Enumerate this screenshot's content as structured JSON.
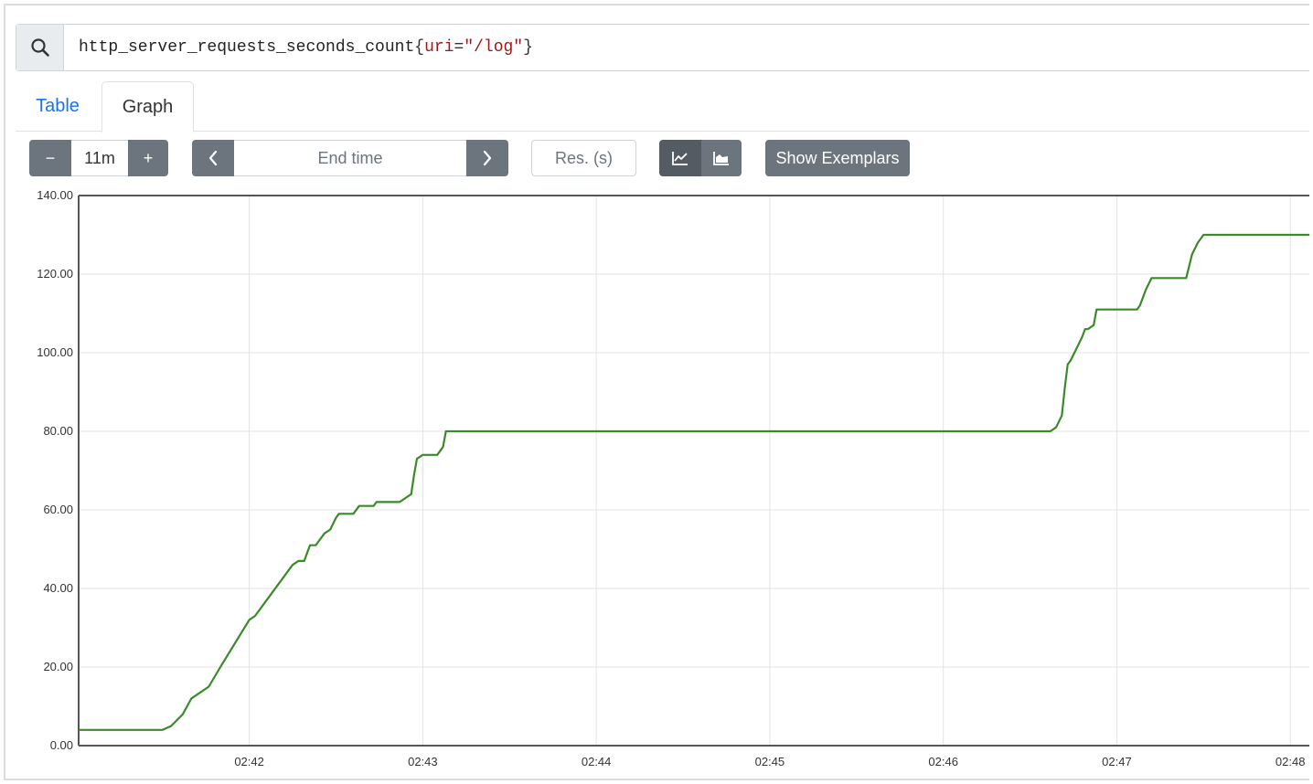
{
  "query": {
    "metric": "http_server_requests_seconds_count",
    "open_brace": "{",
    "label_name": "uri",
    "operator": "=",
    "label_value": "\"/log\"",
    "close_brace": "}",
    "search_icon": "search-icon"
  },
  "tabs": {
    "table_label": "Table",
    "graph_label": "Graph",
    "active": "Graph"
  },
  "controls": {
    "range_minus": "−",
    "range_value": "11m",
    "range_plus": "+",
    "prev_icon": "chevron-left-icon",
    "end_time_placeholder": "End time",
    "next_icon": "chevron-right-icon",
    "resolution_placeholder": "Res. (s)",
    "line_chart_icon": "line-chart-icon",
    "stacked_chart_icon": "area-chart-icon",
    "exemplars_label": "Show Exemplars"
  },
  "colors": {
    "series": "#3a8a2a",
    "button": "#6c757d",
    "button_active": "#545b62",
    "link": "#1a73e8"
  },
  "chart_data": {
    "type": "line",
    "ylim": [
      0,
      140
    ],
    "y_ticks": [
      "0.00",
      "20.00",
      "40.00",
      "60.00",
      "80.00",
      "100.00",
      "120.00",
      "140.00"
    ],
    "x_range": [
      "02:41:01",
      "02:48:11"
    ],
    "x_ticks": [
      "02:42",
      "02:43",
      "02:44",
      "02:45",
      "02:46",
      "02:47",
      "02:48"
    ],
    "grid": true,
    "series": [
      {
        "x": [
          "02:41:01",
          "02:41:30",
          "02:41:33",
          "02:41:37",
          "02:41:40",
          "02:41:42",
          "02:41:46",
          "02:41:50",
          "02:41:55",
          "02:42:00",
          "02:42:02",
          "02:42:05",
          "02:42:10",
          "02:42:15",
          "02:42:17",
          "02:42:19",
          "02:42:21",
          "02:42:23",
          "02:42:24",
          "02:42:26",
          "02:42:28",
          "02:42:30",
          "02:42:31",
          "02:42:33",
          "02:42:36",
          "02:42:38",
          "02:42:42",
          "02:42:43",
          "02:42:44",
          "02:42:48",
          "02:42:49",
          "02:42:52",
          "02:42:56",
          "02:42:57",
          "02:42:58",
          "02:43:00",
          "02:43:05",
          "02:43:07",
          "02:43:08",
          "02:43:12",
          "02:46:37",
          "02:46:39",
          "02:46:41",
          "02:46:42",
          "02:46:43",
          "02:46:44",
          "02:46:46",
          "02:46:48",
          "02:46:49",
          "02:46:50",
          "02:46:52",
          "02:46:53",
          "02:46:54",
          "02:47:00",
          "02:47:07",
          "02:47:08",
          "02:47:10",
          "02:47:12",
          "02:47:24",
          "02:47:26",
          "02:47:28",
          "02:47:30",
          "02:47:31",
          "02:48:11"
        ],
        "values": [
          4,
          4,
          5,
          8,
          12,
          13,
          15,
          20,
          26,
          32,
          33,
          36,
          41,
          46,
          47,
          47,
          51,
          51,
          52,
          54,
          55,
          58,
          59,
          59,
          59,
          61,
          61,
          61,
          62,
          62,
          62,
          62,
          64,
          69,
          73,
          74,
          74,
          76,
          80,
          80,
          80,
          81,
          84,
          91,
          97,
          98,
          101,
          104,
          106,
          106,
          107,
          111,
          111,
          111,
          111,
          112,
          116,
          119,
          119,
          125,
          128,
          130,
          130,
          130
        ]
      }
    ]
  }
}
